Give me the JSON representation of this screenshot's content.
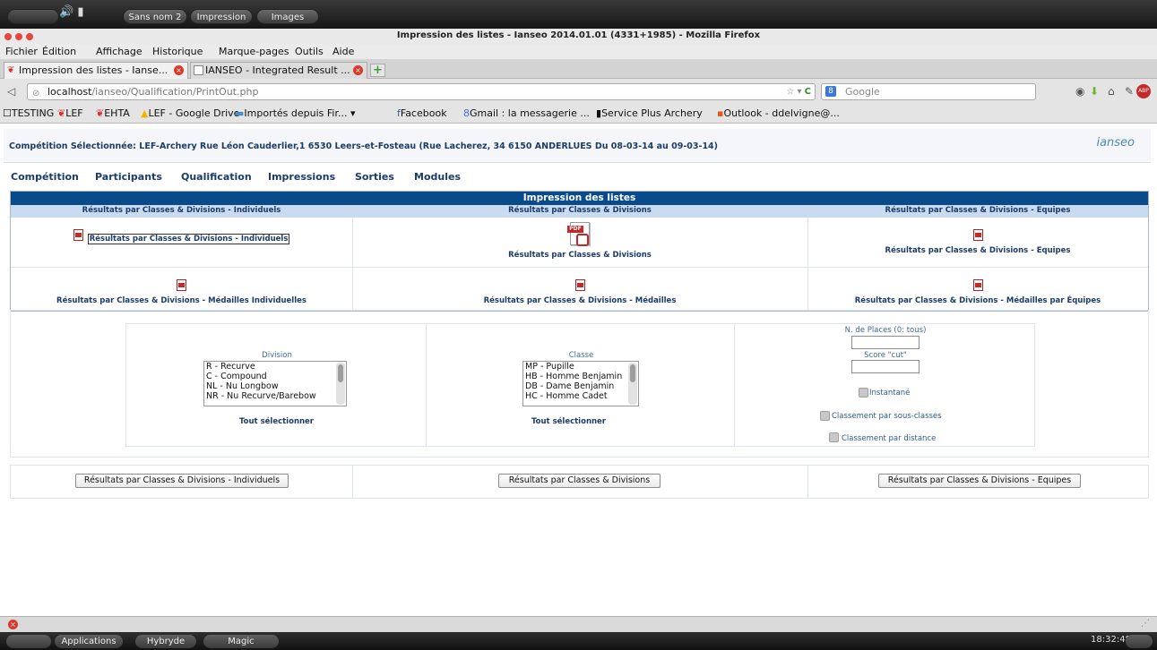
{
  "os_top": {
    "tasks": [
      "Sans nom 2",
      "Impression",
      "Images"
    ]
  },
  "window": {
    "title": "Impression des listes - Ianseo 2014.01.01 (4331+1985) - Mozilla Firefox"
  },
  "menu": [
    "Fichier",
    "Édition",
    "Affichage",
    "Historique",
    "Marque-pages",
    "Outils",
    "Aide"
  ],
  "tabs": [
    {
      "label": "Impression des listes - Ianse..."
    },
    {
      "label": "IANSEO - Integrated Result ..."
    }
  ],
  "url": {
    "host": "localhost",
    "path": "/ianseo/Qualification/PrintOut.php"
  },
  "search": {
    "placeholder": "Google"
  },
  "bookmarks": [
    "TESTING",
    "LEF",
    "EHTA",
    "LEF - Google Drive",
    "Importés depuis Fir... ▾",
    "Facebook",
    "Gmail : la messagerie ...",
    "Service Plus Archery",
    "Outlook - ddelvigne@..."
  ],
  "page": {
    "competition": "Compétition Sélectionnée: LEF-Archery Rue Léon Cauderlier,1 6530 Leers-et-Fosteau (Rue Lacherez, 34 6150 ANDERLUES Du 08-03-14 au 09-03-14)",
    "logo": "ianseo",
    "mainmenu": [
      "Compétition",
      "Participants",
      "Qualification",
      "Impressions",
      "Sorties",
      "Modules"
    ],
    "section_title": "Impression des listes",
    "headers": [
      "Résultats par Classes & Divisions - Individuels",
      "Résultats par Classes & Divisions",
      "Résultats par Classes & Divisions - Equipes"
    ],
    "links_row1": [
      "Résultats par Classes & Divisions - Individuels",
      "Résultats par Classes & Divisions",
      "Résultats par Classes & Divisions - Equipes"
    ],
    "links_row2": [
      "Résultats par Classes & Divisions - Médailles Individuelles",
      "Résultats par Classes & Divisions - Médailles",
      "Résultats par Classes & Divisions - Médailles par Équipes"
    ],
    "division": {
      "label": "Division",
      "items": [
        "R - Recurve",
        "C - Compound",
        "NL - Nu Longbow",
        "NR - Nu Recurve/Barebow"
      ],
      "select_all": "Tout sélectionner"
    },
    "classe": {
      "label": "Classe",
      "items": [
        "MP - Pupille",
        "HB - Homme Benjamin",
        "DB - Dame Benjamin",
        "HC - Homme Cadet"
      ],
      "select_all": "Tout sélectionner"
    },
    "options": {
      "places_label": "N. de Places (0: tous)",
      "score_label": "Score \"cut\"",
      "instantane": "Instantané",
      "sous_classes": "Classement par sous-classes",
      "distance": "Classement par distance"
    },
    "buttons": [
      "Résultats par Classes & Divisions - Individuels",
      "Résultats par Classes & Divisions",
      "Résultats par Classes & Divisions - Equipes"
    ]
  },
  "os_bottom": {
    "items": [
      "Applications",
      "Hybryde",
      "Magic"
    ],
    "clock": "18:32:48"
  }
}
